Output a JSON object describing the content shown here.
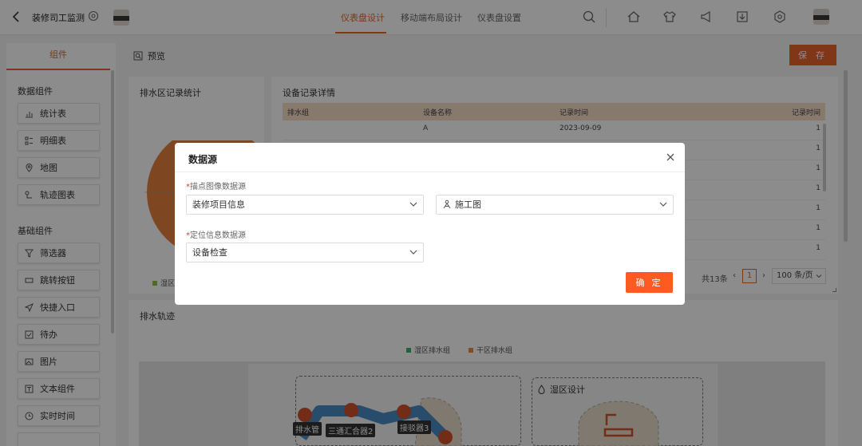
{
  "header": {
    "app_title": "装修司工监测",
    "tabs": [
      {
        "label": "仪表盘设计",
        "active": true
      },
      {
        "label": "移动端布局设计",
        "active": false
      },
      {
        "label": "仪表盘设置",
        "active": false
      }
    ],
    "icons": [
      "search-icon",
      "home-icon",
      "shirt-icon",
      "megaphone-icon",
      "download-icon",
      "settings-icon"
    ],
    "accent_color": "#e8642d"
  },
  "left_panel": {
    "tab_label": "组件",
    "data_group_title": "数据组件",
    "data_items": [
      {
        "label": "统计表",
        "icon": "bar-chart-icon"
      },
      {
        "label": "明细表",
        "icon": "detail-list-icon"
      },
      {
        "label": "地图",
        "icon": "map-pin-icon"
      },
      {
        "label": "轨迹图表",
        "icon": "trajectory-icon"
      }
    ],
    "basic_group_title": "基础组件",
    "basic_items": [
      {
        "label": "筛选器",
        "icon": "filter-icon"
      },
      {
        "label": "跳转按钮",
        "icon": "jump-button-icon"
      },
      {
        "label": "快捷入口",
        "icon": "send-icon"
      },
      {
        "label": "待办",
        "icon": "todo-icon"
      },
      {
        "label": "图片",
        "icon": "image-icon"
      },
      {
        "label": "文本组件",
        "icon": "text-icon"
      },
      {
        "label": "实时时间",
        "icon": "clock-icon"
      }
    ]
  },
  "canvas": {
    "preview_label": "预览",
    "save_label": "保 存",
    "card1_title": "排水区记录统计",
    "card1_legend": "湿区",
    "card2_title": "设备记录详情",
    "table_headers": [
      "排水组",
      "设备名称",
      "记录时间",
      "记录时间"
    ],
    "table_rows": [
      {
        "group": "",
        "name": "A",
        "time": "2023-09-09",
        "count": "1"
      },
      {
        "count": "1"
      },
      {
        "count": "1"
      },
      {
        "count": "1"
      },
      {
        "count": "1"
      },
      {
        "count": "1"
      },
      {
        "count": "1"
      }
    ],
    "pager_total": "共13条",
    "pager_current": "1",
    "pager_size": "100 条/页",
    "card3_title": "排水轨迹",
    "legend_wet": "湿区排水组",
    "legend_dry": "干区排水组",
    "legend_wet_color": "#3cb371",
    "legend_dry_color": "#f08a3c",
    "design_label": "湿区设计",
    "pipe_labels": [
      "排水管",
      "三通汇合器2",
      "接驳器3"
    ]
  },
  "modal": {
    "title": "数据源",
    "field1_label": "描点图像数据源",
    "field1_value": "装修项目信息",
    "field1b_value": "施工图",
    "field2_label": "定位信息数据源",
    "field2_value": "设备检查",
    "confirm_label": "确 定",
    "required_mark": "*"
  }
}
